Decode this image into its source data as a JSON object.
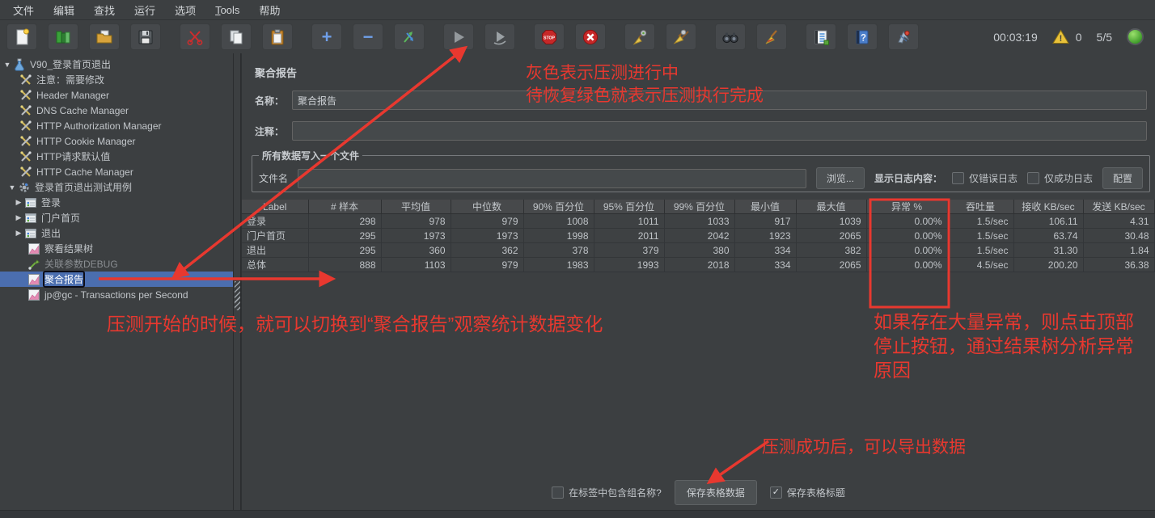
{
  "menu": {
    "items": [
      {
        "label": "文件"
      },
      {
        "label": "编辑"
      },
      {
        "label": "查找"
      },
      {
        "label": "运行"
      },
      {
        "label": "选项"
      },
      {
        "label": "Tools",
        "underline_first": true
      },
      {
        "label": "帮助"
      }
    ]
  },
  "toolbar": {
    "buttons": [
      {
        "name": "new-file"
      },
      {
        "name": "open-template"
      },
      {
        "name": "open-file"
      },
      {
        "name": "save"
      },
      {
        "name": "cut",
        "group_start": true
      },
      {
        "name": "copy"
      },
      {
        "name": "paste"
      },
      {
        "name": "expand-all",
        "group_start": true
      },
      {
        "name": "collapse-all"
      },
      {
        "name": "toggle"
      },
      {
        "name": "start",
        "group_start": true
      },
      {
        "name": "start-no-pauses"
      },
      {
        "name": "stop",
        "group_start": true
      },
      {
        "name": "shutdown"
      },
      {
        "name": "clear",
        "group_start": true
      },
      {
        "name": "clear-all"
      },
      {
        "name": "search",
        "group_start": true
      },
      {
        "name": "search-reset"
      },
      {
        "name": "function-helper",
        "group_start": true
      },
      {
        "name": "help"
      },
      {
        "name": "plugins"
      }
    ],
    "elapsed_time": "00:03:19",
    "error_count": "0",
    "threads": "5/5"
  },
  "tree": {
    "items": [
      {
        "label": "V90_登录首页退出",
        "icon": "test-plan",
        "depth": 0,
        "arrow": "expanded"
      },
      {
        "label": "注意：需要修改",
        "icon": "config-wrench",
        "depth": 1
      },
      {
        "label": "Header Manager",
        "icon": "config-wrench",
        "depth": 1
      },
      {
        "label": "DNS Cache Manager",
        "icon": "config-wrench",
        "depth": 1
      },
      {
        "label": "HTTP Authorization Manager",
        "icon": "config-wrench",
        "depth": 1
      },
      {
        "label": "HTTP Cookie Manager",
        "icon": "config-wrench",
        "depth": 1
      },
      {
        "label": "HTTP请求默认值",
        "icon": "config-wrench",
        "depth": 1
      },
      {
        "label": "HTTP Cache Manager",
        "icon": "config-wrench",
        "depth": 1
      },
      {
        "label": "登录首页退出测试用例",
        "icon": "thread-group-gear",
        "depth": 1,
        "arrow": "expanded"
      },
      {
        "label": "登录",
        "icon": "controller",
        "depth": 2,
        "arrow": "collapsed"
      },
      {
        "label": "门户首页",
        "icon": "controller",
        "depth": 2,
        "arrow": "collapsed"
      },
      {
        "label": "退出",
        "icon": "controller",
        "depth": 2,
        "arrow": "collapsed"
      },
      {
        "label": "察看结果树",
        "icon": "listener-chart",
        "depth": 2
      },
      {
        "label": "关联参数DEBUG",
        "icon": "extractor-dropper",
        "depth": 2,
        "disabled": true
      },
      {
        "label": "聚合报告",
        "icon": "listener-chart",
        "depth": 2,
        "selected": true,
        "boxed": true
      },
      {
        "label": "jp@gc - Transactions per Second",
        "icon": "listener-chart",
        "depth": 2
      }
    ]
  },
  "panel": {
    "title": "聚合报告",
    "name_label": "名称：",
    "name_value": "聚合报告",
    "comment_label": "注释：",
    "comment_value": "",
    "file_group": {
      "legend": "所有数据写入一个文件",
      "filename_label": "文件名",
      "filename_value": "",
      "browse_label": "浏览...",
      "log_display_label": "显示日志内容：",
      "errors_only_label": "仅错误日志",
      "errors_only_checked": false,
      "success_only_label": "仅成功日志",
      "success_only_checked": false,
      "configure_label": "配置"
    },
    "table": {
      "columns": [
        "Label",
        "# 样本",
        "平均值",
        "中位数",
        "90% 百分位",
        "95% 百分位",
        "99% 百分位",
        "最小值",
        "最大值",
        "异常 %",
        "吞吐量",
        "接收 KB/sec",
        "发送 KB/sec"
      ],
      "rows": [
        [
          "登录",
          "298",
          "978",
          "979",
          "1008",
          "1011",
          "1033",
          "917",
          "1039",
          "0.00%",
          "1.5/sec",
          "106.11",
          "4.31"
        ],
        [
          "门户首页",
          "295",
          "1973",
          "1973",
          "1998",
          "2011",
          "2042",
          "1923",
          "2065",
          "0.00%",
          "1.5/sec",
          "63.74",
          "30.48"
        ],
        [
          "退出",
          "295",
          "360",
          "362",
          "378",
          "379",
          "380",
          "334",
          "382",
          "0.00%",
          "1.5/sec",
          "31.30",
          "1.84"
        ],
        [
          "总体",
          "888",
          "1103",
          "979",
          "1983",
          "1993",
          "2018",
          "334",
          "2065",
          "0.00%",
          "4.5/sec",
          "200.20",
          "36.38"
        ]
      ]
    },
    "footer": {
      "include_group_label": "在标签中包含组名称?",
      "include_group_checked": false,
      "save_table_label": "保存表格数据",
      "save_header_label": "保存表格标题",
      "save_header_checked": true
    }
  },
  "annotations": {
    "color": "#e8382f",
    "running_note_line1": "灰色表示压测进行中",
    "running_note_line2": "待恢复绿色就表示压测执行完成",
    "switch_note": "压测开始的时候，就可以切换到“聚合报告”观察统计数据变化",
    "error_note_line1": "如果存在大量异常，则点击顶部",
    "error_note_line2": "停止按钮，通过结果树分析异常",
    "error_note_line3": "原因",
    "export_note": "压测成功后，可以导出数据"
  }
}
